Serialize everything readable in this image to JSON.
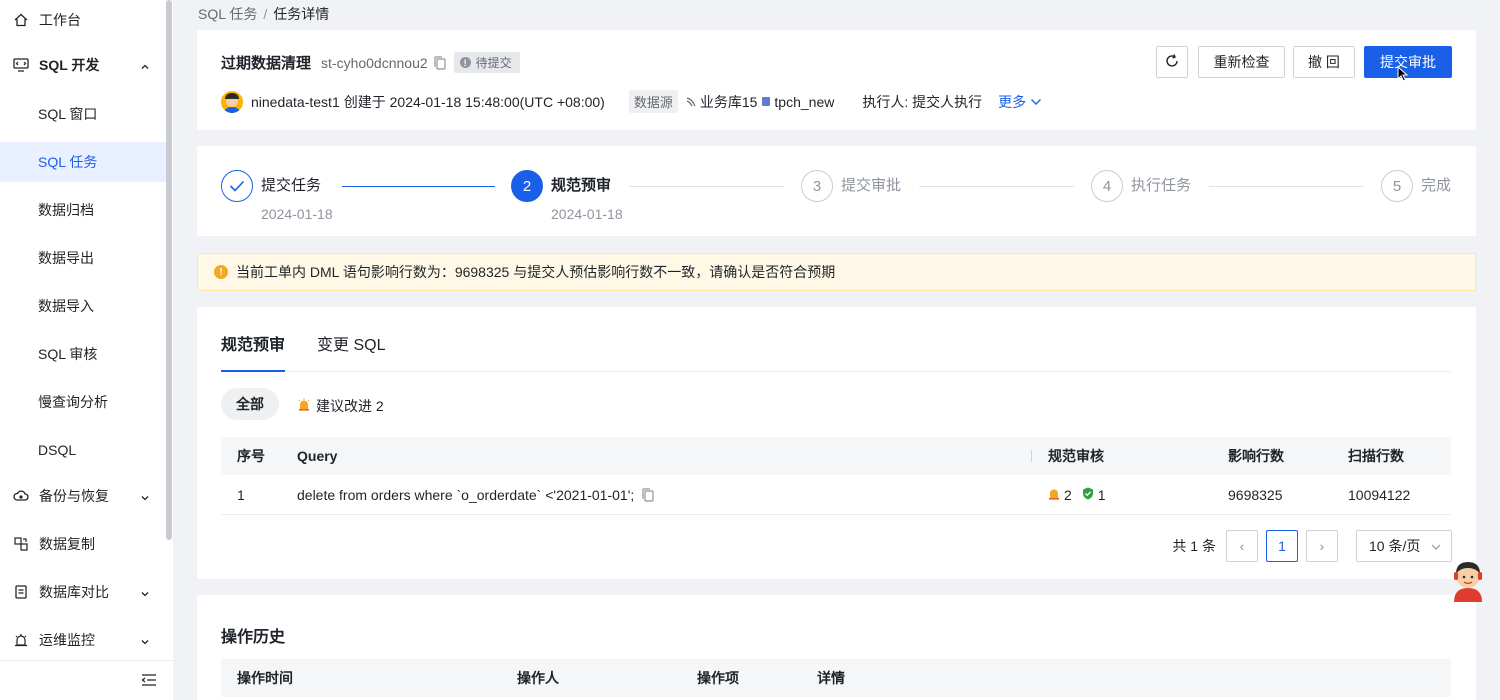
{
  "sidebar": {
    "items": [
      {
        "label": "工作台",
        "icon": "home-icon"
      },
      {
        "label": "SQL 开发",
        "icon": "monitor-code-icon"
      },
      {
        "label": "SQL 窗口"
      },
      {
        "label": "SQL 任务"
      },
      {
        "label": "数据归档"
      },
      {
        "label": "数据导出"
      },
      {
        "label": "数据导入"
      },
      {
        "label": "SQL 审核"
      },
      {
        "label": "慢查询分析"
      },
      {
        "label": "DSQL"
      },
      {
        "label": "备份与恢复",
        "icon": "cloud-backup-icon"
      },
      {
        "label": "数据复制",
        "icon": "replicate-icon"
      },
      {
        "label": "数据库对比",
        "icon": "compare-icon"
      },
      {
        "label": "运维监控",
        "icon": "alarm-icon"
      }
    ]
  },
  "breadcrumb": {
    "parent": "SQL 任务",
    "separator": "/",
    "current": "任务详情"
  },
  "task": {
    "title": "过期数据清理",
    "id": "st-cyho0dcnnou2",
    "status": "待提交",
    "creator": "ninedata-test1",
    "created_text": "创建于 2024-01-18 15:48:00(UTC +08:00)",
    "datasource_label": "数据源",
    "datasource": "业务库15",
    "database": "tpch_new",
    "executor": "执行人:  提交人执行",
    "more": "更多"
  },
  "actions": {
    "recheck": "重新检查",
    "withdraw": "撤 回",
    "submit": "提交审批"
  },
  "steps": [
    {
      "num": "",
      "label": "提交任务",
      "date": "2024-01-18",
      "state": "done"
    },
    {
      "num": "2",
      "label": "规范预审",
      "date": "2024-01-18",
      "state": "active"
    },
    {
      "num": "3",
      "label": "提交审批",
      "date": "",
      "state": "wait"
    },
    {
      "num": "4",
      "label": "执行任务",
      "date": "",
      "state": "wait"
    },
    {
      "num": "5",
      "label": "完成",
      "date": "",
      "state": "wait"
    }
  ],
  "alert": {
    "text": "当前工单内 DML 语句影响行数为：9698325 与提交人预估影响行数不一致，请确认是否符合预期"
  },
  "review": {
    "tabs": [
      "规范预审",
      "变更 SQL"
    ],
    "filters": {
      "all": "全部",
      "suggest": "建议改进 2"
    },
    "columns": [
      "序号",
      "Query",
      "规范审核",
      "影响行数",
      "扫描行数"
    ],
    "rows": [
      {
        "index": "1",
        "query": "delete from orders where `o_orderdate` <'2021-01-01';",
        "warn_count": "2",
        "pass_count": "1",
        "affected": "9698325",
        "scanned": "10094122"
      }
    ],
    "pager": {
      "total": "共 1 条",
      "page": "1",
      "size": "10 条/页",
      "prev": "‹",
      "next": "›"
    }
  },
  "history": {
    "title": "操作历史",
    "columns": [
      "操作时间",
      "操作人",
      "操作项",
      "详情"
    ]
  },
  "colors": {
    "primary": "#1a5fe8",
    "warning": "#f5a623",
    "success": "#2ea043"
  }
}
